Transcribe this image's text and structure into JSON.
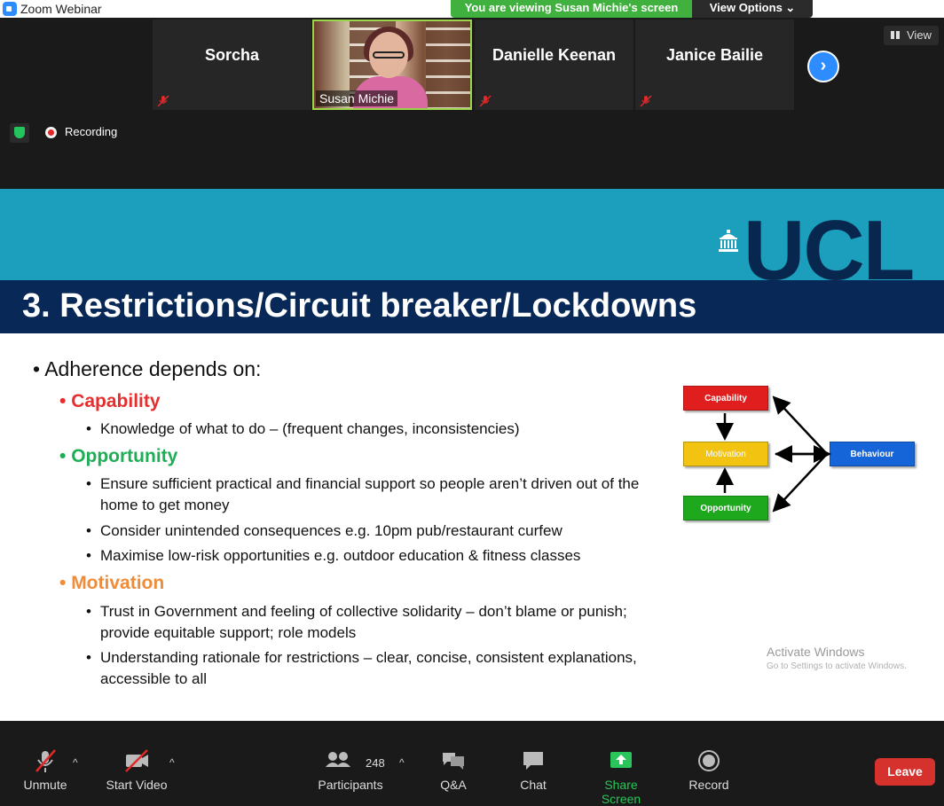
{
  "window": {
    "title": "Zoom Webinar"
  },
  "banner": {
    "viewing_text": "You are viewing Susan Michie's screen",
    "view_options_label": "View Options ⌄"
  },
  "participants_strip": {
    "tiles": [
      {
        "name": "Sorcha",
        "muted": true
      },
      {
        "name": "Susan Michie",
        "video": true
      },
      {
        "name": "Danielle Keenan",
        "muted": true
      },
      {
        "name": "Janice Bailie",
        "muted": true
      }
    ],
    "view_label": "View"
  },
  "status": {
    "recording_label": "Recording"
  },
  "slide": {
    "logo_text": "UCL",
    "title": "3. Restrictions/Circuit breaker/Lockdowns",
    "intro": "Adherence depends on:",
    "capability": {
      "heading": "Capability",
      "items": [
        "Knowledge of what to do – (frequent changes, inconsistencies)"
      ]
    },
    "opportunity": {
      "heading": "Opportunity",
      "items": [
        "Ensure sufficient practical and financial support so people aren’t driven out of the home  to get money",
        "Consider unintended consequences e.g. 10pm pub/restaurant curfew",
        "Maximise low-risk opportunities e.g. outdoor education & fitness classes"
      ]
    },
    "motivation": {
      "heading": "Motivation",
      "items": [
        "Trust in Government and feeling of collective solidarity – don’t blame or punish; provide equitable support; role models",
        "Understanding rationale for restrictions – clear, concise, consistent explanations, accessible to all"
      ]
    },
    "diagram": {
      "capability": "Capability",
      "motivation": "Motivation",
      "opportunity": "Opportunity",
      "behaviour": "Behaviour"
    },
    "watermark": {
      "title": "Activate Windows",
      "subtitle": "Go to Settings to activate Windows."
    },
    "colors": {
      "band": "#1b9fbd",
      "title_band": "#082957",
      "capability": "#e52f2f",
      "opportunity": "#1fae55",
      "motivation": "#ee8c3a"
    }
  },
  "toolbar": {
    "unmute": "Unmute",
    "start_video": "Start Video",
    "participants": "Participants",
    "participants_count": "248",
    "qa": "Q&A",
    "chat": "Chat",
    "share_screen": "Share Screen",
    "record": "Record",
    "leave": "Leave"
  }
}
